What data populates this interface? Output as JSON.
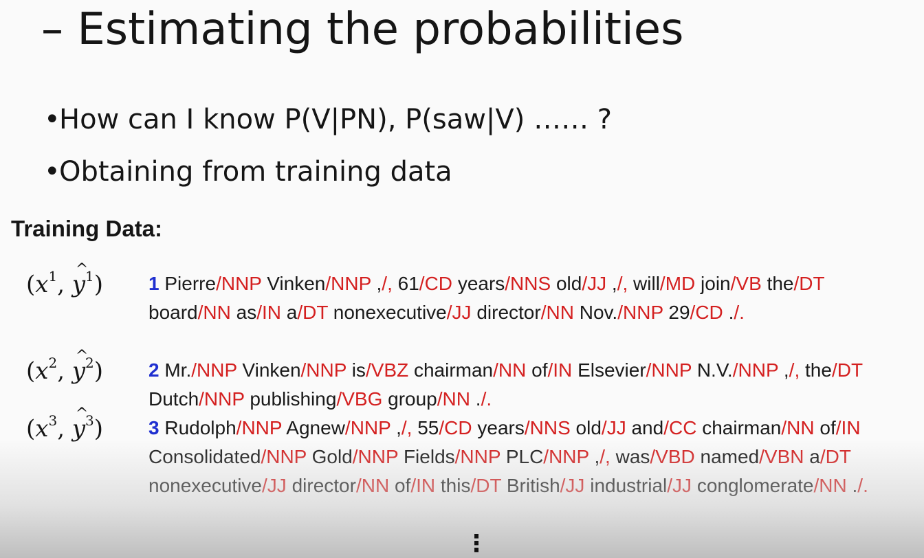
{
  "slide": {
    "title": "– Estimating the probabilities",
    "bullets": [
      "How can I know P(V|PN), P(saw|V) …… ?",
      "Obtaining from training data"
    ],
    "training_heading": "Training Data:",
    "continuation": "⋮"
  },
  "colors": {
    "tag": "#d42020",
    "sentence_number": "#1f2fd0",
    "text": "#1a1a1a"
  },
  "examples": [
    {
      "var_x": "x",
      "var_y": "y",
      "index": "1",
      "number": "1",
      "tokens": [
        [
          "Pierre",
          "NNP"
        ],
        [
          "Vinken",
          "NNP"
        ],
        [
          ",",
          ","
        ],
        [
          "61",
          "CD"
        ],
        [
          "years",
          "NNS"
        ],
        [
          "old",
          "JJ"
        ],
        [
          ",",
          ","
        ],
        [
          "will",
          "MD"
        ],
        [
          "join",
          "VB"
        ],
        [
          "the",
          "DT"
        ],
        [
          "board",
          "NN"
        ],
        [
          "as",
          "IN"
        ],
        [
          "a",
          "DT"
        ],
        [
          "nonexecutive",
          "JJ"
        ],
        [
          "director",
          "NN"
        ],
        [
          "Nov.",
          "NNP"
        ],
        [
          "29",
          "CD"
        ],
        [
          ".",
          "."
        ]
      ]
    },
    {
      "var_x": "x",
      "var_y": "y",
      "index": "2",
      "number": "2",
      "tokens": [
        [
          "Mr.",
          "NNP"
        ],
        [
          "Vinken",
          "NNP"
        ],
        [
          "is",
          "VBZ"
        ],
        [
          "chairman",
          "NN"
        ],
        [
          "of",
          "IN"
        ],
        [
          "Elsevier",
          "NNP"
        ],
        [
          "N.V.",
          "NNP"
        ],
        [
          ",",
          ","
        ],
        [
          "the",
          "DT"
        ],
        [
          "Dutch",
          "NNP"
        ],
        [
          "publishing",
          "VBG"
        ],
        [
          "group",
          "NN"
        ],
        [
          ".",
          "."
        ]
      ]
    },
    {
      "var_x": "x",
      "var_y": "y",
      "index": "3",
      "number": "3",
      "tokens": [
        [
          "Rudolph",
          "NNP"
        ],
        [
          "Agnew",
          "NNP"
        ],
        [
          ",",
          ","
        ],
        [
          "55",
          "CD"
        ],
        [
          "years",
          "NNS"
        ],
        [
          "old",
          "JJ"
        ],
        [
          "and",
          "CC"
        ],
        [
          "chairman",
          "NN"
        ],
        [
          "of",
          "IN"
        ],
        [
          "Consolidated",
          "NNP"
        ],
        [
          "Gold",
          "NNP"
        ],
        [
          "Fields",
          "NNP"
        ],
        [
          "PLC",
          "NNP"
        ],
        [
          ",",
          ","
        ],
        [
          "was",
          "VBD"
        ],
        [
          "named",
          "VBN"
        ],
        [
          "a",
          "DT"
        ],
        [
          "nonexecutive",
          "JJ"
        ],
        [
          "director",
          "NN"
        ],
        [
          "of",
          "IN"
        ],
        [
          "this",
          "DT"
        ],
        [
          "British",
          "JJ"
        ],
        [
          "industrial",
          "JJ"
        ],
        [
          "conglomerate",
          "NN"
        ],
        [
          ".",
          "."
        ]
      ]
    }
  ]
}
